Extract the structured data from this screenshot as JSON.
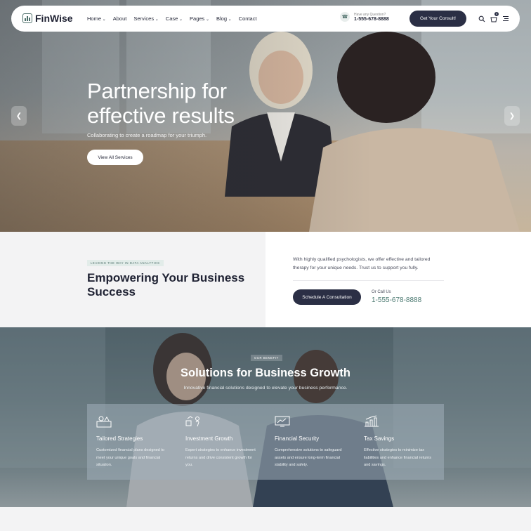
{
  "nav": {
    "logo": "FinWise",
    "menu": [
      {
        "label": "Home",
        "dropdown": true
      },
      {
        "label": "About",
        "dropdown": false
      },
      {
        "label": "Services",
        "dropdown": true
      },
      {
        "label": "Case",
        "dropdown": true
      },
      {
        "label": "Pages",
        "dropdown": true
      },
      {
        "label": "Blog",
        "dropdown": true
      },
      {
        "label": "Contact",
        "dropdown": false
      }
    ],
    "phone_question": "Have any Question?",
    "phone_number": "1-555-678-8888",
    "cta": "Get Your Consult!",
    "cart_count": "0"
  },
  "hero": {
    "title_line1": "Partnership for",
    "title_line2": "effective results",
    "subtitle": "Collaborating to create a roadmap for your triumph.",
    "button": "View All Services",
    "prev_icon": "chevron-left-icon",
    "next_icon": "chevron-right-icon"
  },
  "intro": {
    "tag": "LEADING THE WAY IN DATA ANALYTICS",
    "title": "Empowering Your Business Success",
    "text": "With highly qualified psychologists, we offer effective and tailored therapy for your unique needs. Trust us to support you fully.",
    "button": "Schedule A Consultation",
    "call_label": "Or Call Us",
    "call_number": "1-555-678-8888"
  },
  "benefits": {
    "tag": "OUR BENEFIT",
    "title": "Solutions for Business Growth",
    "subtitle": "Innovative financial solutions designed to elevate your business performance.",
    "items": [
      {
        "icon": "strategy-icon",
        "title": "Tailored Strategies",
        "desc": "Customized financial plans designed to meet your unique goals and financial situation."
      },
      {
        "icon": "growth-icon",
        "title": "Investment Growth",
        "desc": "Expert strategies to enhance investment returns and drive consistent growth for you."
      },
      {
        "icon": "security-icon",
        "title": "Financial Security",
        "desc": "Comprehensive solutions to safeguard assets and ensure long-term financial stability and safety."
      },
      {
        "icon": "chart-icon",
        "title": "Tax Savings",
        "desc": "Effective strategies to minimize tax liabilities and enhance financial returns and savings."
      }
    ]
  },
  "colors": {
    "primary": "#2b2f45",
    "accent": "#4d7a72",
    "background": "#f3f3f4"
  }
}
